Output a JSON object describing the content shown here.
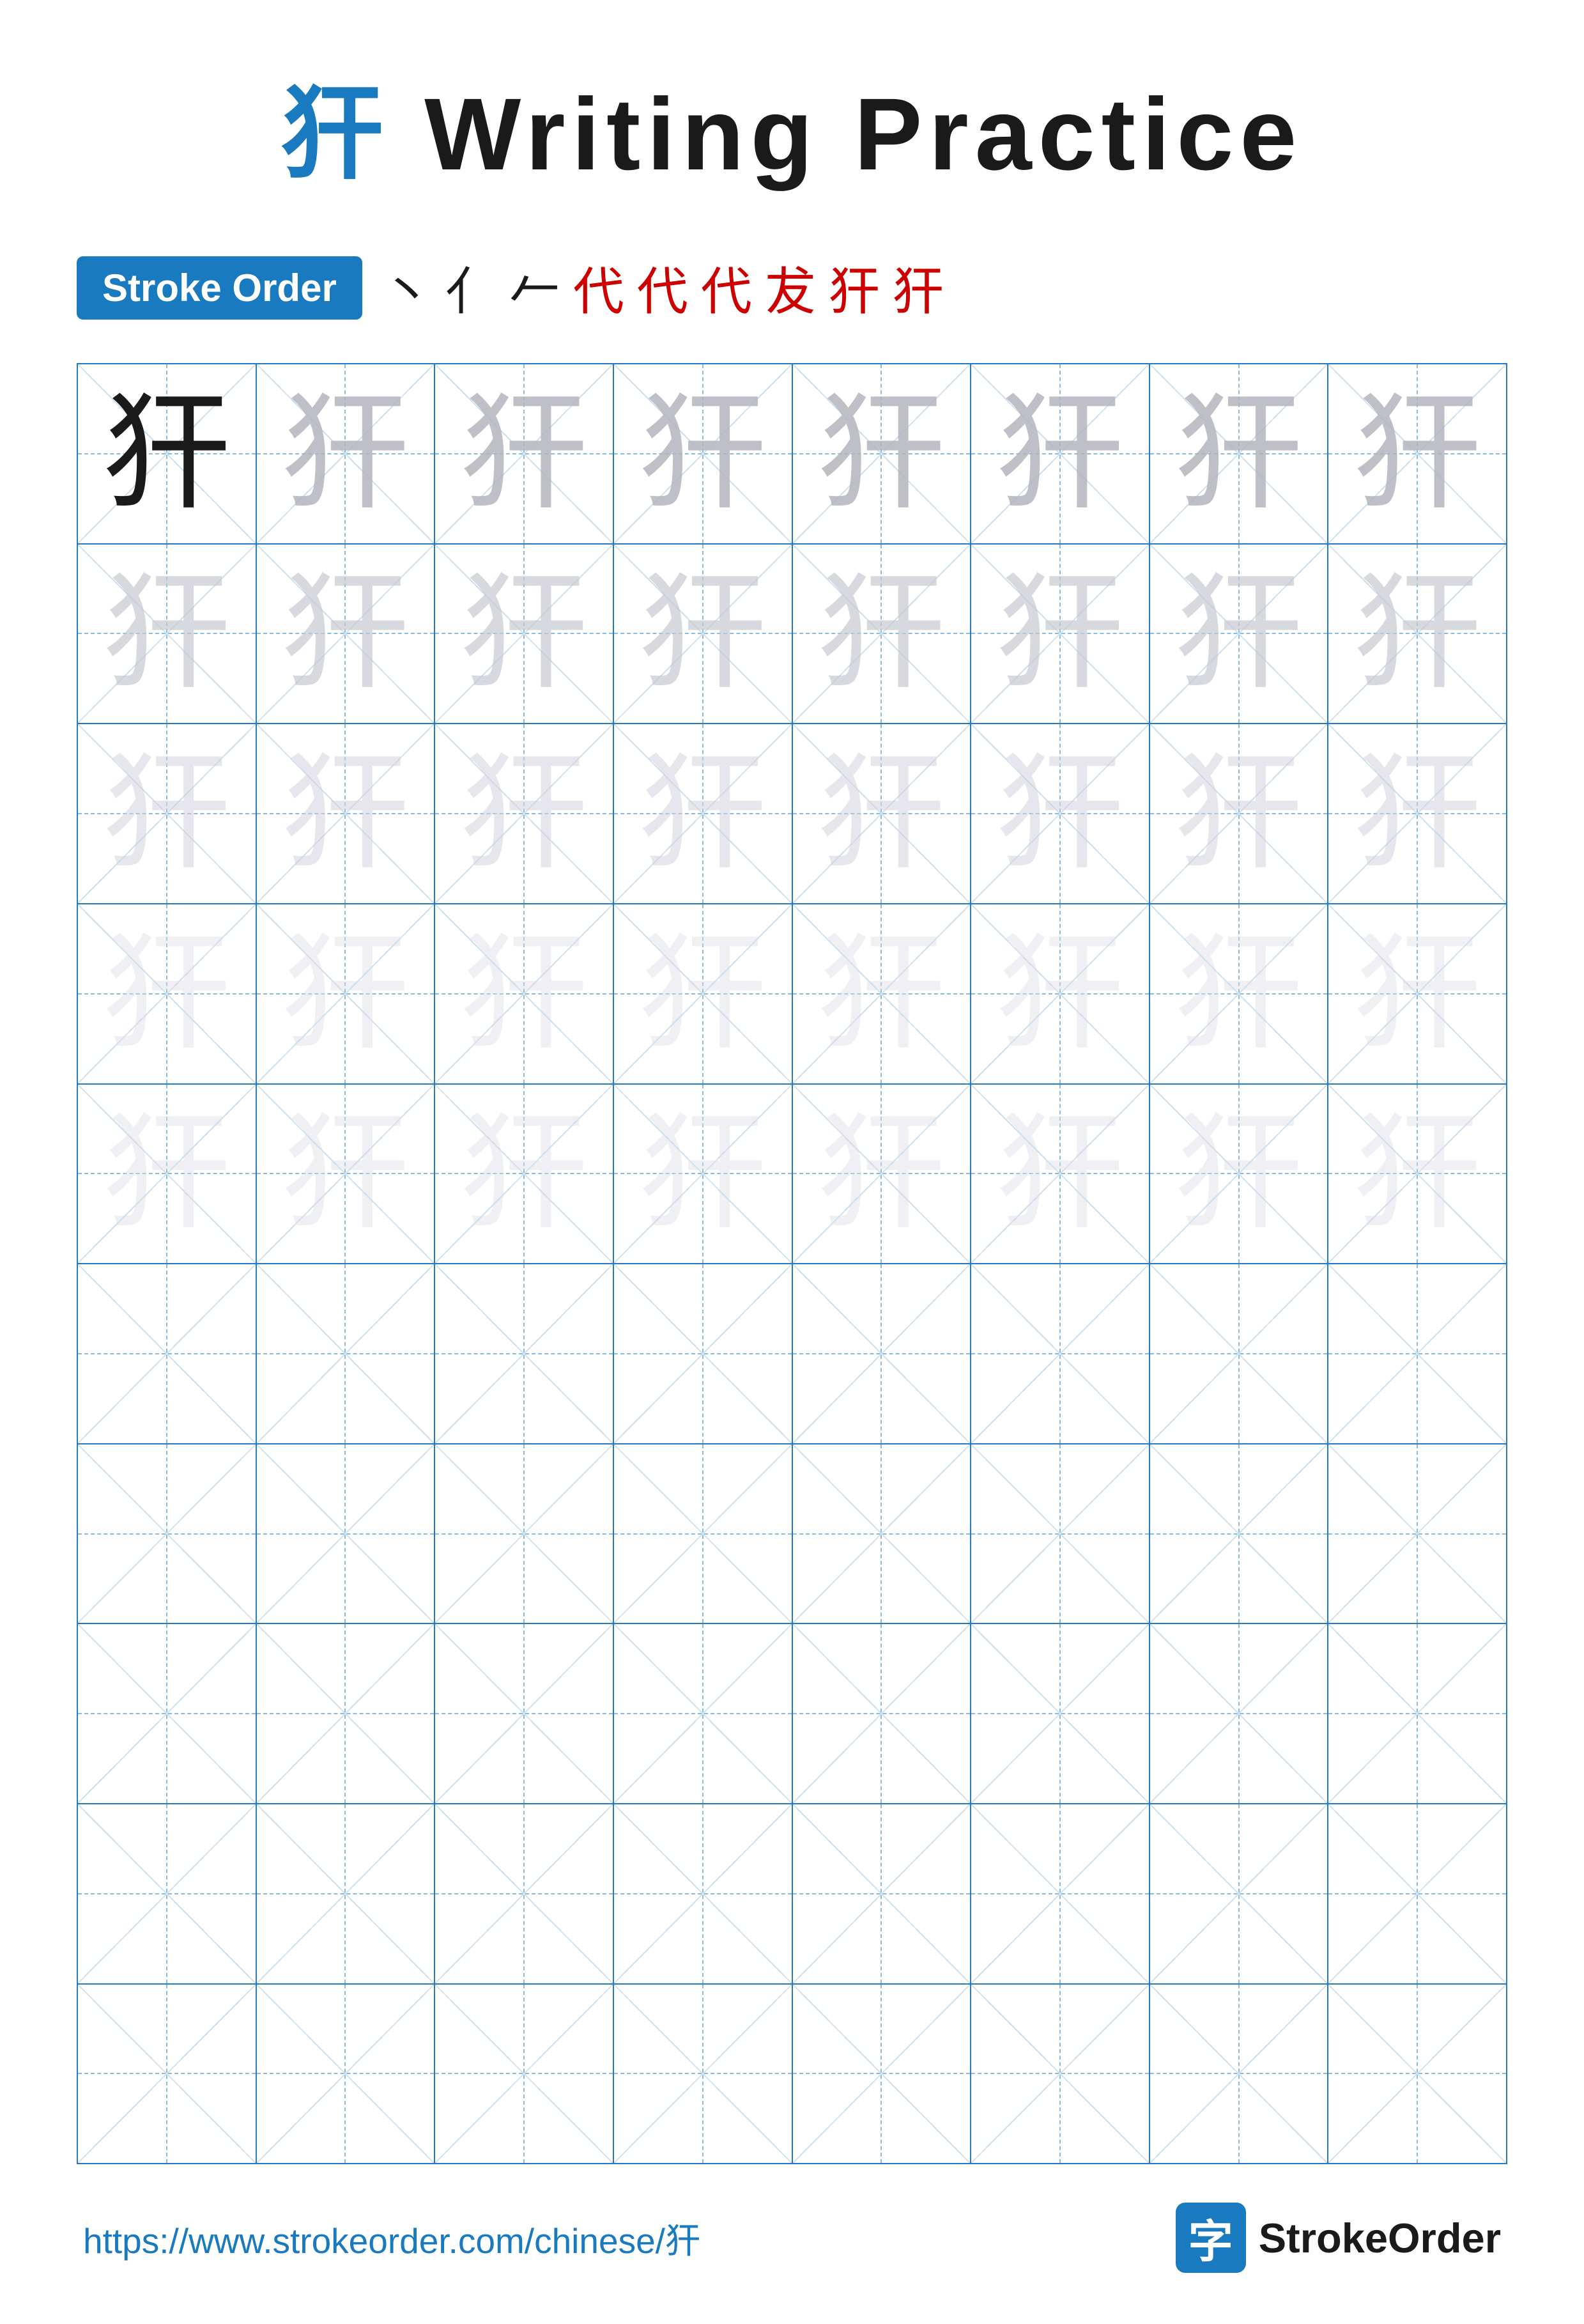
{
  "title": {
    "char": "犴",
    "text": "Writing Practice",
    "full": "犴 Writing Practice"
  },
  "stroke_order": {
    "badge_label": "Stroke Order",
    "strokes": [
      "丶",
      "亻",
      "𠂉",
      "代",
      "代",
      "代",
      "犮",
      "犴",
      "犴"
    ]
  },
  "grid": {
    "rows": 10,
    "cols": 8,
    "character": "犴",
    "practice_rows": 5,
    "empty_rows": 5
  },
  "footer": {
    "url": "https://www.strokeorder.com/chinese/犴",
    "brand": "StrokeOrder",
    "icon_char": "字"
  }
}
